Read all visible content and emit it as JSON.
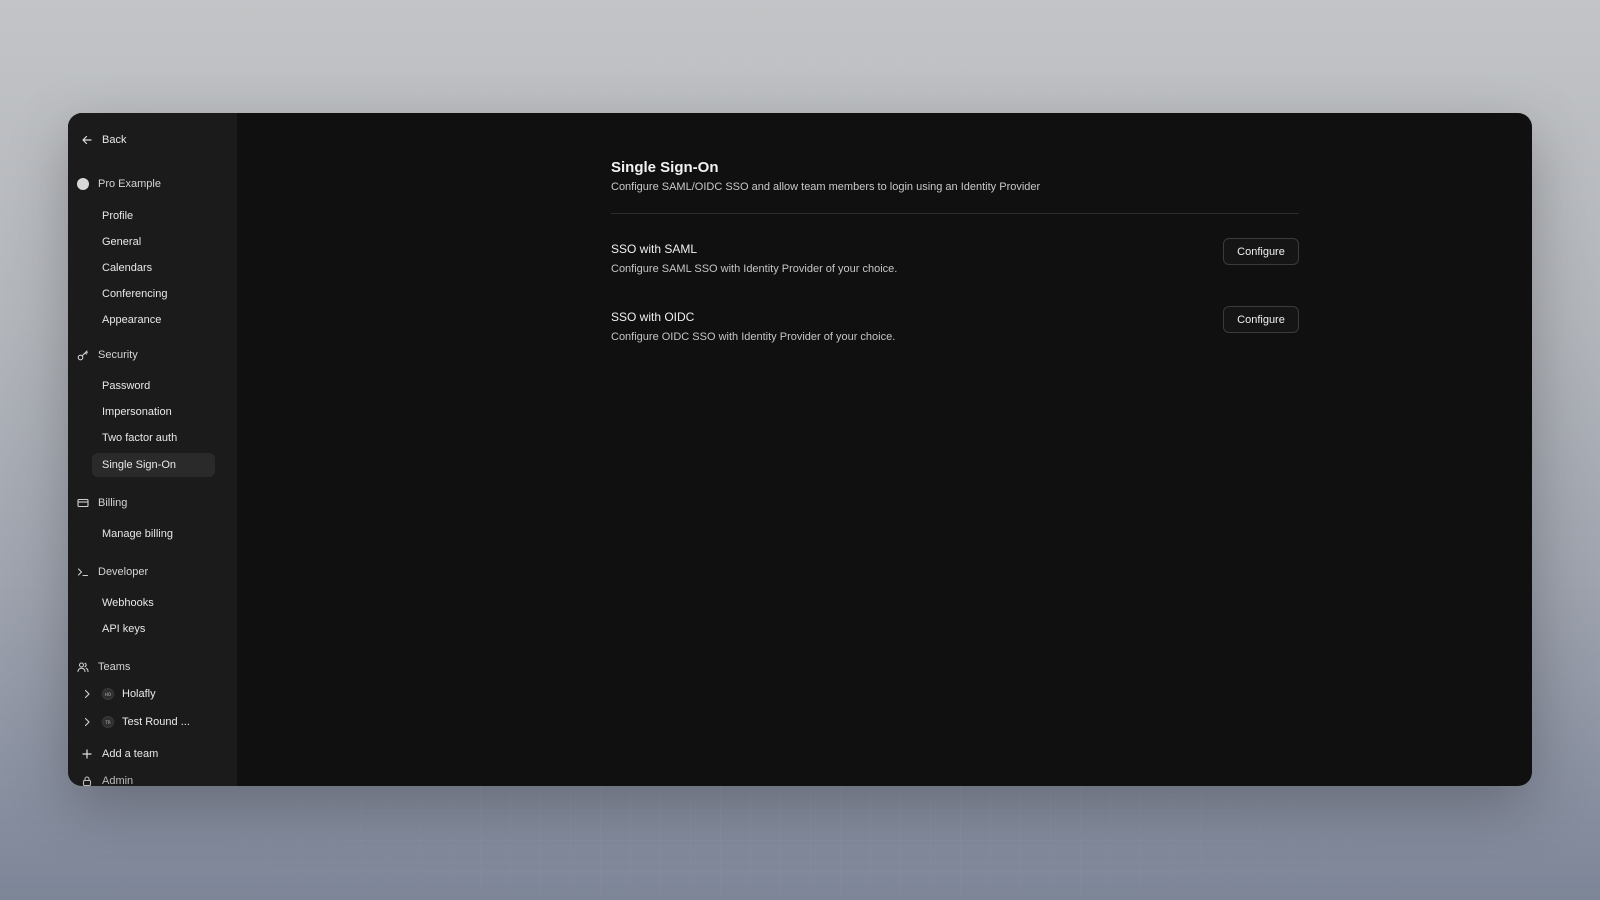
{
  "sidebar": {
    "back_label": "Back",
    "profile_section": {
      "label": "Pro Example",
      "items": [
        "Profile",
        "General",
        "Calendars",
        "Conferencing",
        "Appearance"
      ]
    },
    "security_section": {
      "label": "Security",
      "items": [
        "Password",
        "Impersonation",
        "Two factor auth",
        "Single Sign-On"
      ],
      "active_item": "Single Sign-On"
    },
    "billing_section": {
      "label": "Billing",
      "items": [
        "Manage billing"
      ]
    },
    "developer_section": {
      "label": "Developer",
      "items": [
        "Webhooks",
        "API keys"
      ]
    },
    "teams_section": {
      "label": "Teams",
      "teams": [
        {
          "name": "Holafly",
          "initials": "HO"
        },
        {
          "name": "Test Round ...",
          "initials": "TR"
        }
      ],
      "add_team_label": "Add a team"
    },
    "admin_label": "Admin"
  },
  "main": {
    "title": "Single Sign-On",
    "description": "Configure SAML/OIDC SSO and allow team members to login using an Identity Provider",
    "options": [
      {
        "title": "SSO with SAML",
        "description": "Configure SAML SSO with Identity Provider of your choice.",
        "button_label": "Configure"
      },
      {
        "title": "SSO with OIDC",
        "description": "Configure OIDC SSO with Identity Provider of your choice.",
        "button_label": "Configure"
      }
    ]
  },
  "colors": {
    "window_bg": "#101010",
    "sidebar_bg": "#1b1b1b",
    "active_item_bg": "#2a2a2a",
    "text_primary": "#f0f0f0"
  },
  "icons": {
    "back": "arrow-left-icon",
    "profile": "avatar-circle-icon",
    "security": "key-icon",
    "billing": "credit-card-icon",
    "developer": "terminal-icon",
    "teams": "users-icon",
    "team_expand": "chevron-right-icon",
    "add": "plus-icon",
    "admin": "lock-icon"
  }
}
